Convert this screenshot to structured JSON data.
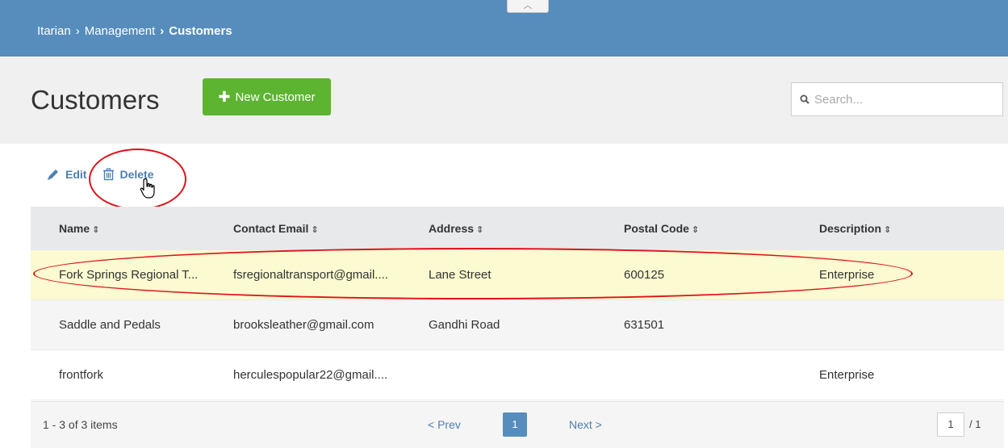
{
  "breadcrumb": {
    "root": "Itarian",
    "sep1": "›",
    "mid": "Management",
    "sep2": "›",
    "current": "Customers"
  },
  "collapse_icon": "chevron-up-icon",
  "page": {
    "title": "Customers",
    "new_button": "New Customer",
    "new_icon": "plus-icon"
  },
  "search": {
    "placeholder": "Search...",
    "icon": "search-icon"
  },
  "toolbar": {
    "edit": "Edit",
    "edit_icon": "pencil-icon",
    "delete": "Delete",
    "delete_icon": "trash-icon"
  },
  "table": {
    "columns": [
      "Name",
      "Contact Email",
      "Address",
      "Postal Code",
      "Description"
    ],
    "sort_glyph": "⇕",
    "rows": [
      [
        "Fork Springs Regional T...",
        "fsregionaltransport@gmail....",
        "Lane Street",
        "600125",
        "Enterprise"
      ],
      [
        "Saddle and Pedals",
        "brooksleather@gmail.com",
        "Gandhi Road",
        "631501",
        ""
      ],
      [
        "frontfork",
        "herculespopular22@gmail....",
        "",
        "",
        "Enterprise"
      ]
    ]
  },
  "pagination": {
    "info": "1 - 3 of 3 items",
    "prev": "< Prev",
    "current": "1",
    "next": "Next >",
    "page_input": "1",
    "total": "/ 1"
  },
  "colors": {
    "header": "#568dbc",
    "accent_green": "#5cb431",
    "link": "#4d7fb4",
    "selected_row": "#fbfad0",
    "annotation": "#e0121b"
  }
}
